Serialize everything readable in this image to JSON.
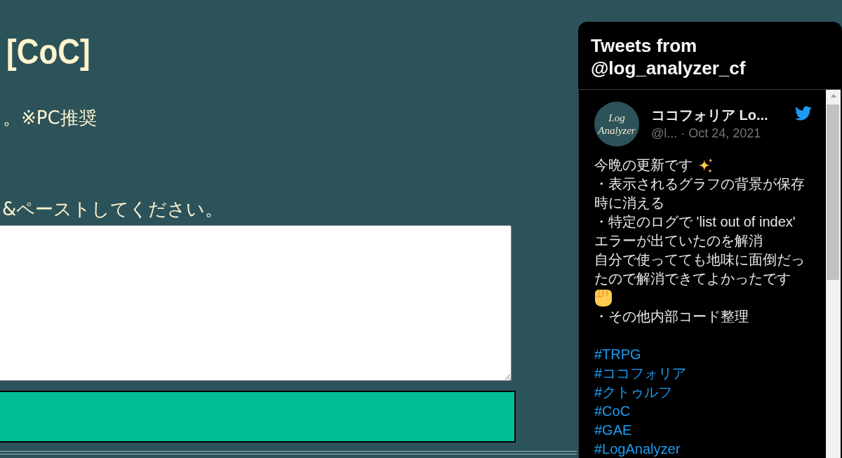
{
  "main": {
    "title": "[CoC]",
    "notice": "。※PC推奨",
    "instruction": "&ペーストしてください。"
  },
  "twitter_widget": {
    "title": "Tweets from @log_analyzer_cf",
    "tweet": {
      "avatar_text": [
        "Log",
        "Analyzer"
      ],
      "name": "ココフォリア Lo...",
      "byline": "@l... · Oct 24, 2021",
      "lines": [
        {
          "kind": "sparkle",
          "text": "今晩の更新です"
        },
        {
          "kind": "text",
          "text": "・表示されるグラフの背景が保存"
        },
        {
          "kind": "text",
          "text": "時に消える"
        },
        {
          "kind": "text",
          "text": "・特定のログで 'list out of index'"
        },
        {
          "kind": "text",
          "text": "エラーが出ていたのを解消"
        },
        {
          "kind": "text",
          "text": "自分で使ってても地味に面倒だっ"
        },
        {
          "kind": "text",
          "text": "たので解消できてよかったです"
        },
        {
          "kind": "fist"
        },
        {
          "kind": "text",
          "text": "・その他内部コード整理"
        }
      ],
      "hashtags": [
        "#TRPG",
        "#ココフォリア",
        "#クトゥルフ",
        "#CoC",
        "#GAE",
        "#LogAnalyzer"
      ]
    }
  }
}
